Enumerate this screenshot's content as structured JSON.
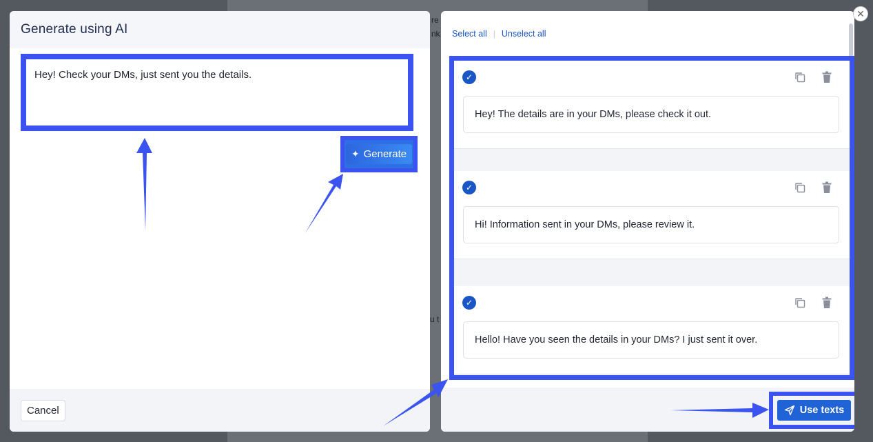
{
  "background": {
    "fragment_a": "re",
    "fragment_b": "nk",
    "fragment_c": "u t"
  },
  "left_panel": {
    "title": "Generate using AI",
    "prompt_value": "Hey! Check your DMs, just sent you the details.",
    "generate_label": "Generate",
    "cancel_label": "Cancel"
  },
  "right_panel": {
    "select_all_label": "Select all",
    "unselect_all_label": "Unselect all",
    "items": [
      {
        "text": "Hey! The details are in your DMs, please check it out.",
        "checked": true
      },
      {
        "text": "Hi! Information sent in your DMs, please review it.",
        "checked": true
      },
      {
        "text": "Hello! Have you seen the details in your DMs? I just sent it over.",
        "checked": true
      }
    ],
    "use_texts_label": "Use texts"
  },
  "colors": {
    "annotation_blue": "#3b54f0",
    "primary_button": "#1f63d6",
    "link_blue": "#1a56c5"
  },
  "icons": [
    "sparkle-icon",
    "check-circle-icon",
    "copy-icon",
    "trash-icon",
    "send-icon",
    "close-icon"
  ]
}
